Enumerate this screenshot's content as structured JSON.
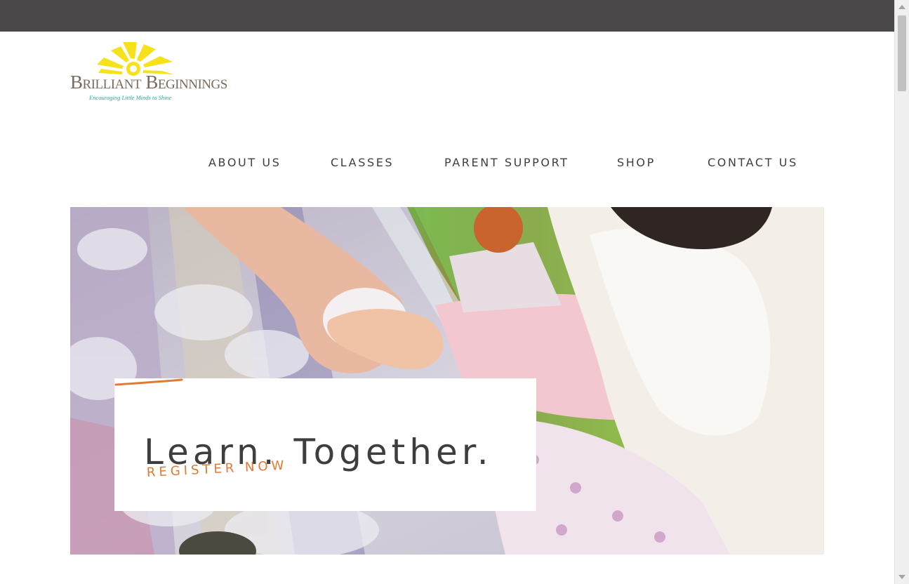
{
  "logo": {
    "name": "Brilliant Beginnings",
    "tagline": "Encouraging Little Minds to Shine",
    "sun_color": "#f5e21a",
    "name_color": "#7a6a5d",
    "tagline_color": "#2fa3a0"
  },
  "nav": {
    "items": [
      {
        "label": "ABOUT US"
      },
      {
        "label": "CLASSES"
      },
      {
        "label": "PARENT SUPPORT"
      },
      {
        "label": "SHOP"
      },
      {
        "label": "CONTACT US"
      }
    ]
  },
  "hero": {
    "headline": "Learn. Together.",
    "cta_label": "REGISTER NOW",
    "cta_color": "#e07a35"
  },
  "colors": {
    "topbar": "#4a4849",
    "text": "#3e3e3e"
  }
}
